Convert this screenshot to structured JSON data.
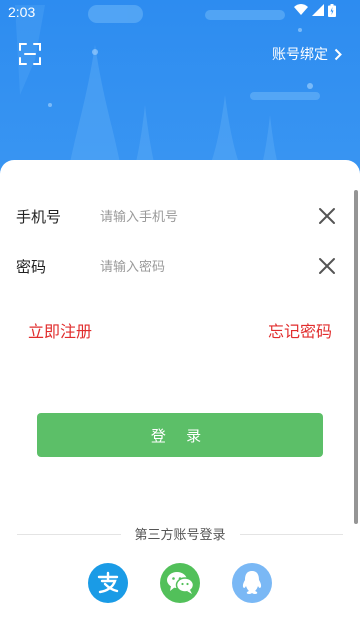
{
  "status": {
    "time": "2:03"
  },
  "header": {
    "bind_label": "账号绑定"
  },
  "form": {
    "phone_label": "手机号",
    "phone_placeholder": "请输入手机号",
    "password_label": "密码",
    "password_placeholder": "请输入密码"
  },
  "links": {
    "register": "立即注册",
    "forgot": "忘记密码"
  },
  "login_button": "登 录",
  "third_party": {
    "title": "第三方账号登录",
    "providers": [
      "alipay-icon",
      "wechat-icon",
      "qq-icon"
    ]
  },
  "colors": {
    "header_blue": "#2f8ff0",
    "login_green": "#5cbf68",
    "link_red": "#e12d2d",
    "alipay": "#1a9be6",
    "wechat": "#52c05a",
    "qq": "#7ab8f5"
  }
}
